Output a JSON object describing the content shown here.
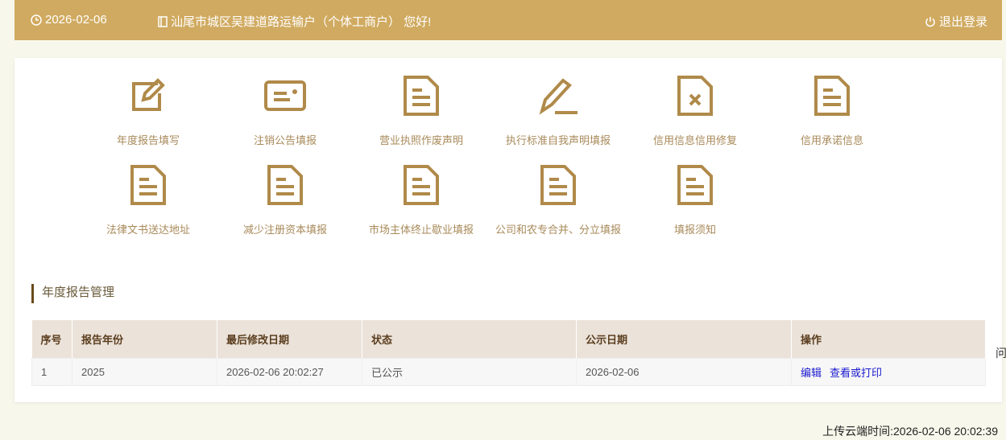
{
  "header": {
    "date": "2026-02-06",
    "greeting": "汕尾市城区吴建道路运输户（个体工商户） 您好!",
    "logout": "退出登录"
  },
  "tiles": [
    {
      "label": "年度报告填写",
      "icon": "edit-icon"
    },
    {
      "label": "注销公告填报",
      "icon": "card-icon"
    },
    {
      "label": "营业执照作废声明",
      "icon": "document-icon"
    },
    {
      "label": "执行标准自我声明填报",
      "icon": "pen-icon"
    },
    {
      "label": "信用信息信用修复",
      "icon": "document-x-icon"
    },
    {
      "label": "信用承诺信息",
      "icon": "document-icon"
    },
    {
      "label": "法律文书送达地址",
      "icon": "document-icon"
    },
    {
      "label": "减少注册资本填报",
      "icon": "document-icon"
    },
    {
      "label": "市场主体终止歇业填报",
      "icon": "document-icon"
    },
    {
      "label": "公司和农专合并、分立填报",
      "icon": "document-icon"
    },
    {
      "label": "填报须知",
      "icon": "document-icon"
    }
  ],
  "section_title": "年度报告管理",
  "table": {
    "headers": [
      "序号",
      "报告年份",
      "最后修改日期",
      "状态",
      "公示日期",
      "操作"
    ],
    "rows": [
      {
        "no": "1",
        "year": "2025",
        "modified": "2026-02-06 20:02:27",
        "status": "已公示",
        "published": "2026-02-06",
        "edit": "编辑",
        "view": "查看或打印"
      }
    ]
  },
  "stray_char": "问",
  "footer": "上传云端时间:2026-02-06 20:02:39"
}
